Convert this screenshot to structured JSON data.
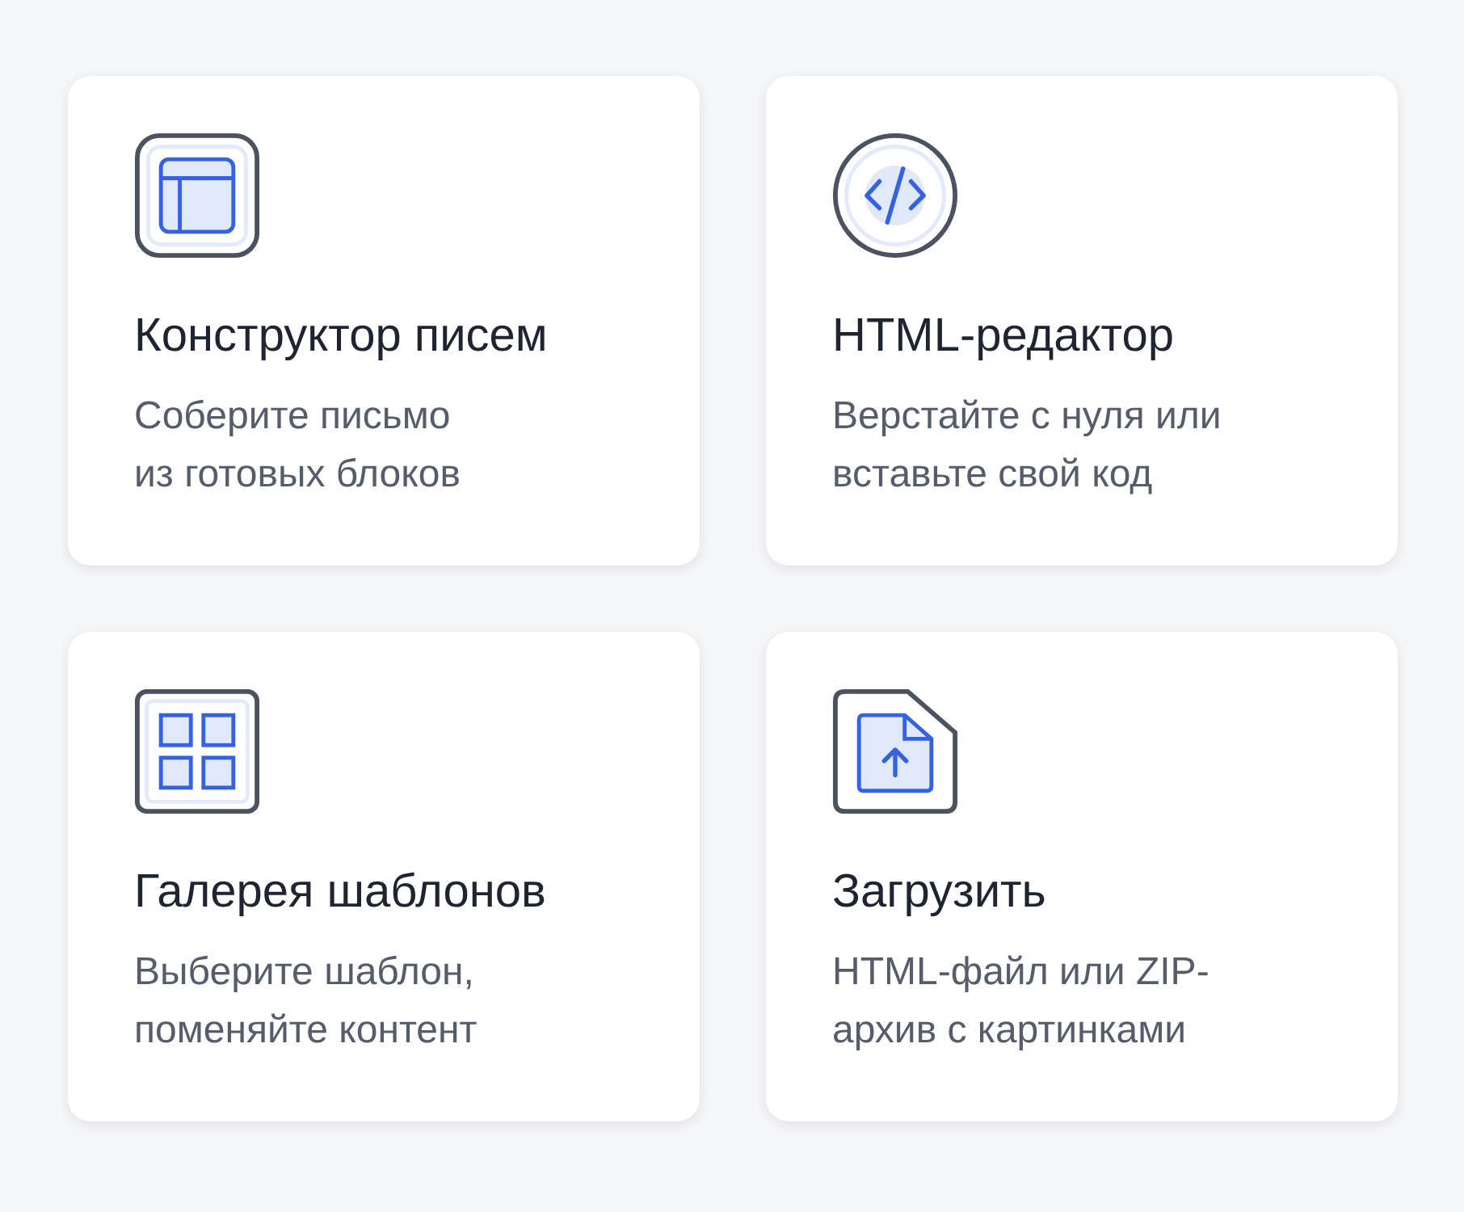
{
  "options": [
    {
      "kind": "builder",
      "title": "Конструктор писем",
      "description": "Соберите письмо\nиз готовых блоков"
    },
    {
      "kind": "html",
      "title": "HTML-редактор",
      "description": "Верстайте с нуля или\nвставьте свой код"
    },
    {
      "kind": "gallery",
      "title": "Галерея шаблонов",
      "description": "Выберите шаблон,\nпоменяйте контент"
    },
    {
      "kind": "upload",
      "title": "Загрузить",
      "description": "HTML-файл или ZIP-\nархив с картинками"
    }
  ]
}
